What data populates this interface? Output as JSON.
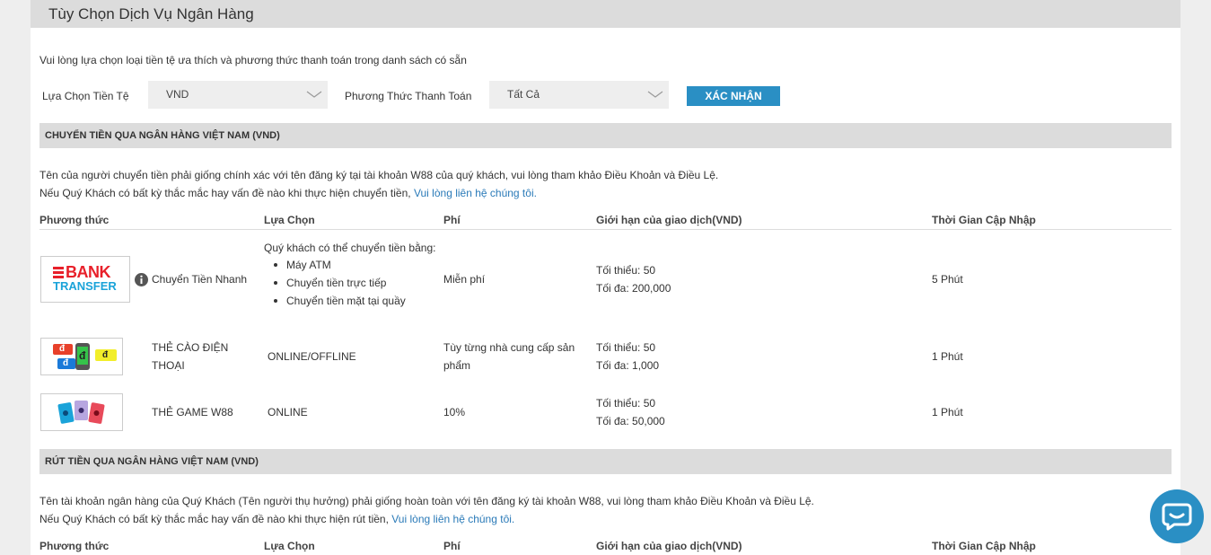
{
  "page": {
    "title": "Tùy Chọn Dịch Vụ Ngân Hàng"
  },
  "intro": "Vui lòng lựa chọn loại tiền tệ ưa thích và phương thức thanh toán trong danh sách có sẵn",
  "filters": {
    "currency_label": "Lựa Chọn Tiền Tệ",
    "currency_value": "VND",
    "method_label": "Phương Thức Thanh Toán",
    "method_value": "Tất Cả",
    "confirm_label": "XÁC NHẬN"
  },
  "columns": {
    "method": "Phương thức",
    "option": "Lựa Chọn",
    "fee": "Phí",
    "limit": "Giới hạn của giao dịch(VND)",
    "time": "Thời Gian Cập Nhập"
  },
  "deposit": {
    "title": "CHUYỂN TIỀN QUA NGÂN HÀNG VIỆT NAM (VND)",
    "note1": "Tên của người chuyển tiền phải giống chính xác với tên đăng ký tại tài khoản W88 của quý khách, vui lòng tham khảo Điều Khoản và Điều Lệ.",
    "note2_prefix": "Nếu Quý Khách có bất kỳ thắc mắc hay vấn đề nào khi thực hiện chuyển tiền, ",
    "note2_link": "Vui lòng liên hệ chúng tôi.",
    "rows": [
      {
        "logo_line1": "BANK",
        "logo_line2": "TRANSFER",
        "name": "Chuyển Tiền Nhanh",
        "option_intro": "Quý khách có thể chuyển tiền bằng:",
        "options": [
          "Máy ATM",
          "Chuyển tiền trực tiếp",
          "Chuyển tiền mặt tại quầy"
        ],
        "fee": "Miễn phí",
        "min": "Tối thiểu: 50",
        "max": "Tối đa: 200,000",
        "time": "5 Phút"
      },
      {
        "logo_glyph": "đ",
        "name_line1": "THẺ CÀO ĐIỆN",
        "name_line2": "THOẠI",
        "option": "ONLINE/OFFLINE",
        "fee_line1": "Tùy từng nhà cung cấp sản",
        "fee_line2": "phẩm",
        "min": "Tối thiểu: 50",
        "max": "Tối đa: 1,000",
        "time": "1 Phút"
      },
      {
        "name": "THẺ GAME W88",
        "option": "ONLINE",
        "fee": "10%",
        "min": "Tối thiểu: 50",
        "max": "Tối đa: 50,000",
        "time": "1 Phút"
      }
    ]
  },
  "withdraw": {
    "title": "RÚT TIỀN QUA NGÂN HÀNG VIỆT NAM (VND)",
    "note1": "Tên tài khoản ngân hàng của Quý Khách (Tên người thụ hưởng) phải giống hoàn toàn với tên đăng ký tài khoản W88, vui lòng tham khảo Điều Khoản và Điều Lệ.",
    "note2_prefix": "Nếu Quý Khách có bất kỳ thắc mắc hay vấn đề nào khi thực hiện rút tiền, ",
    "note2_link": "Vui lòng liên hệ chúng tôi."
  },
  "colors": {
    "accent": "#2a8fc4",
    "link": "#2a7ab8",
    "bank_red": "#e8202a",
    "bank_blue": "#1aa3d9"
  },
  "icons": [
    "chevron-down-icon",
    "info-icon",
    "chat-icon"
  ]
}
